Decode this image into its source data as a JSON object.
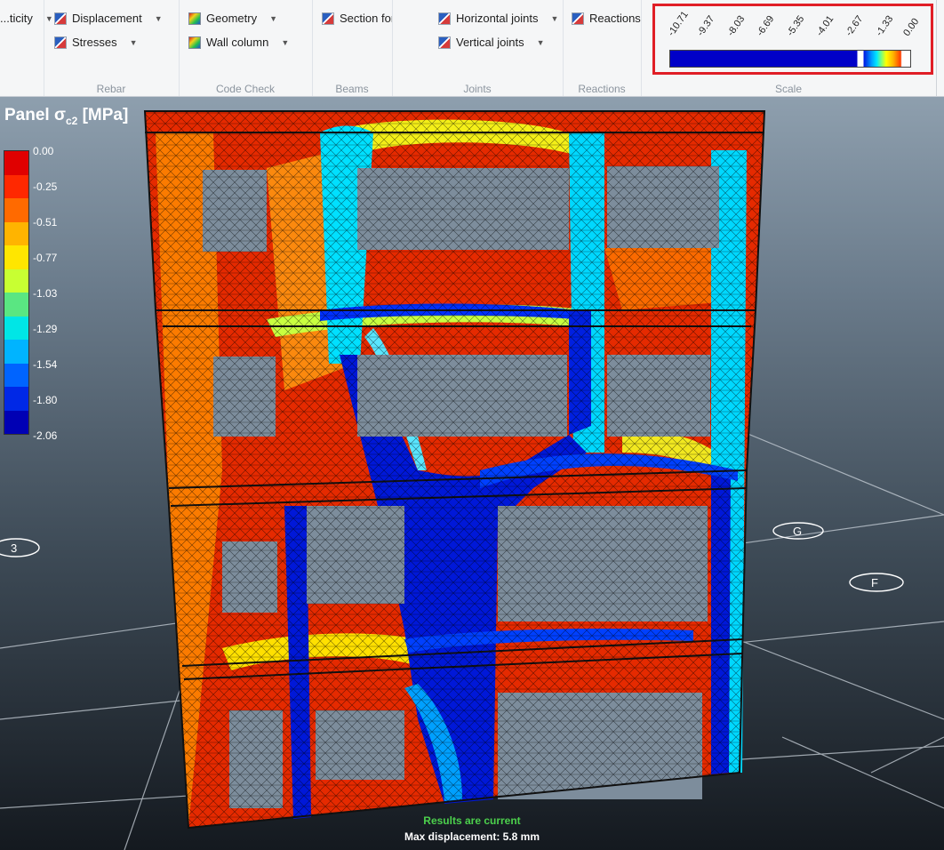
{
  "ribbon": {
    "groups": [
      {
        "label": "",
        "buttons": [
          "...ticity"
        ]
      },
      {
        "label": "Rebar",
        "buttons": [
          "Displacement",
          "Stresses"
        ]
      },
      {
        "label": "Code Check",
        "buttons": [
          "Geometry",
          "Wall column"
        ]
      },
      {
        "label": "Beams",
        "buttons": [
          "Section for..."
        ]
      },
      {
        "label": "Joints",
        "buttons": [
          "Horizontal joints",
          "Vertical joints"
        ]
      },
      {
        "label": "Reactions",
        "buttons": [
          "Reactions"
        ]
      },
      {
        "label": "Scale",
        "buttons": []
      }
    ],
    "scale_ticks": [
      "-10.71",
      "-9.37",
      "-8.03",
      "-6.69",
      "-5.35",
      "-4.01",
      "-2.67",
      "-1.33",
      "0.00"
    ]
  },
  "legend": {
    "title_main": "Panel σ",
    "title_sub": "c2",
    "title_unit": " [MPa]",
    "labels": [
      "0.00",
      "-0.25",
      "-0.51",
      "-0.77",
      "-1.03",
      "-1.29",
      "-1.54",
      "-1.80",
      "-2.06"
    ],
    "colors": [
      "#e00000",
      "#ff2800",
      "#ff6a00",
      "#ffb400",
      "#ffe600",
      "#c8ff32",
      "#5ae682",
      "#00e6e6",
      "#00b4ff",
      "#0064ff",
      "#0028e6",
      "#0000b4"
    ]
  },
  "grid_markers": [
    "3",
    "G",
    "F"
  ],
  "status": {
    "results": "Results are current",
    "max_displacement": "Max displacement: 5.8 mm"
  }
}
